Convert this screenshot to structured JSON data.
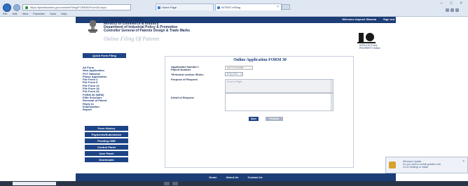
{
  "browser": {
    "url": "https://ipindiaonline.gov.in/onlineFiling/FORM30/Form30.aspx",
    "tabs": [
      "Home Page",
      "INTENT eFiling"
    ],
    "menu": [
      "File",
      "Edit",
      "View",
      "Favorites",
      "Tools",
      "Help"
    ]
  },
  "header": {
    "welcome": "Welcome Aayush Sharma",
    "signout": "Sign out",
    "gov_lines": [
      "GOVERNMENT of INDIA",
      "Ministry of Commerce & Industry",
      "Department of Industrial Policy & Promotion",
      "Controller General of Patents Design & Trade Marks"
    ],
    "online_filing": "Online Filing Of Patents",
    "ip_text_lines": [
      "INTELLECTUAL",
      "PROPERTY INDIA"
    ]
  },
  "sidebar": {
    "quick_form": "Quick Form Filing",
    "links": [
      "All Form",
      "New Application",
      "PCT National Phase Application",
      "File Form 2",
      "File Form 5",
      "File Form 13",
      "File Form 18",
      "File Form 28",
      "FORM 30 (NEW)",
      "Fifth Schedule",
      "Renewal of Patent",
      "Reply to Examination Report"
    ],
    "buttons": [
      "Form History",
      "Payments/Submission",
      "Pending CBR",
      "Control Panel",
      "User Panel",
      "Downloads"
    ]
  },
  "form": {
    "title": "Online Application FORM 30",
    "app_number_label": "Application Number / Patent Number",
    "app_number_value": "201717024388",
    "section_label": "*Relevant section /Rules",
    "section_value": "57(1) R10",
    "purpose_label": "Purpose of Request",
    "purpose_value": "Proof of Right",
    "detail_label": "Detail of Request",
    "save": "Save",
    "preview": "Preview"
  },
  "footer": {
    "links": [
      "Home",
      "About Us",
      "Contact Us"
    ]
  },
  "notification": {
    "lines": [
      "Windows Update",
      "Do you want to install updates now",
      "Go to Settings to install"
    ]
  },
  "colors": {
    "navy": "#1c3d75",
    "button": "#1d4486"
  }
}
